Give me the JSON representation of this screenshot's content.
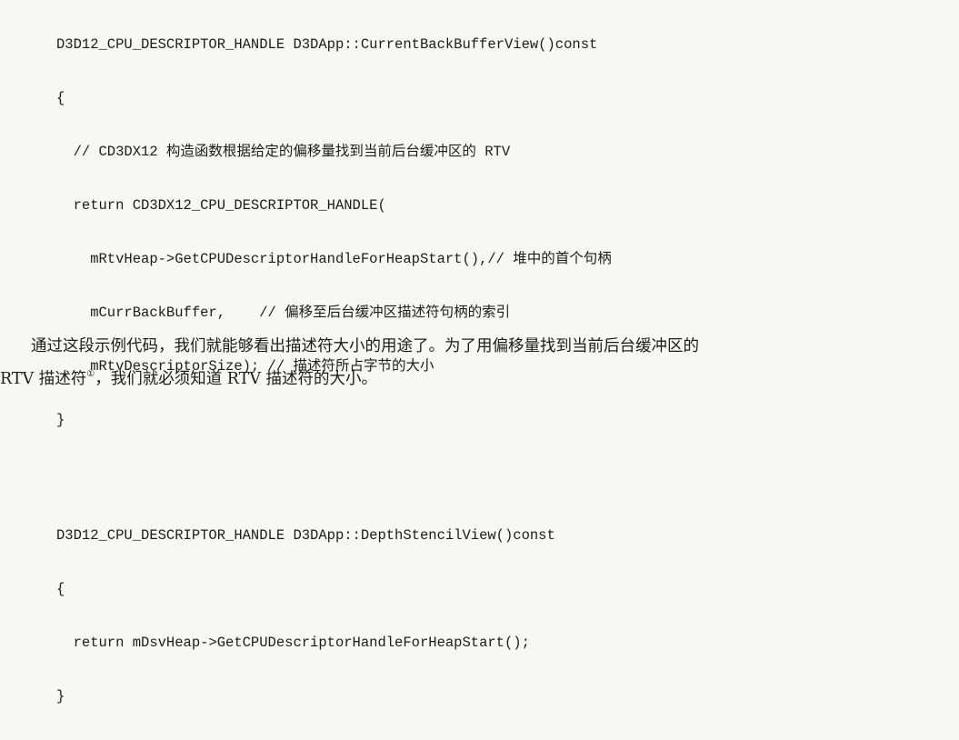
{
  "code_block_1": [
    "D3D12_CPU_DESCRIPTOR_HANDLE D3DApp::CurrentBackBufferView()const",
    "{",
    "  // CD3DX12 构造函数根据给定的偏移量找到当前后台缓冲区的 RTV",
    "  return CD3DX12_CPU_DESCRIPTOR_HANDLE(",
    "    mRtvHeap->GetCPUDescriptorHandleForHeapStart(),// 堆中的首个句柄",
    "    mCurrBackBuffer,    // 偏移至后台缓冲区描述符句柄的索引",
    "    mRtvDescriptorSize); // 描述符所占字节的大小",
    "}"
  ],
  "code_block_2": [
    "D3D12_CPU_DESCRIPTOR_HANDLE D3DApp::DepthStencilView()const",
    "{",
    "  return mDsvHeap->GetCPUDescriptorHandleForHeapStart();",
    "}"
  ],
  "paragraph": {
    "line1": "通过这段示例代码，我们就能够看出描述符大小的用途了。为了用偏移量找到当前后台缓冲区的",
    "line2_before": "RTV 描述符",
    "footnote_mark": "①",
    "line2_after": "，我们就必须知道 RTV 描述符的大小。"
  }
}
